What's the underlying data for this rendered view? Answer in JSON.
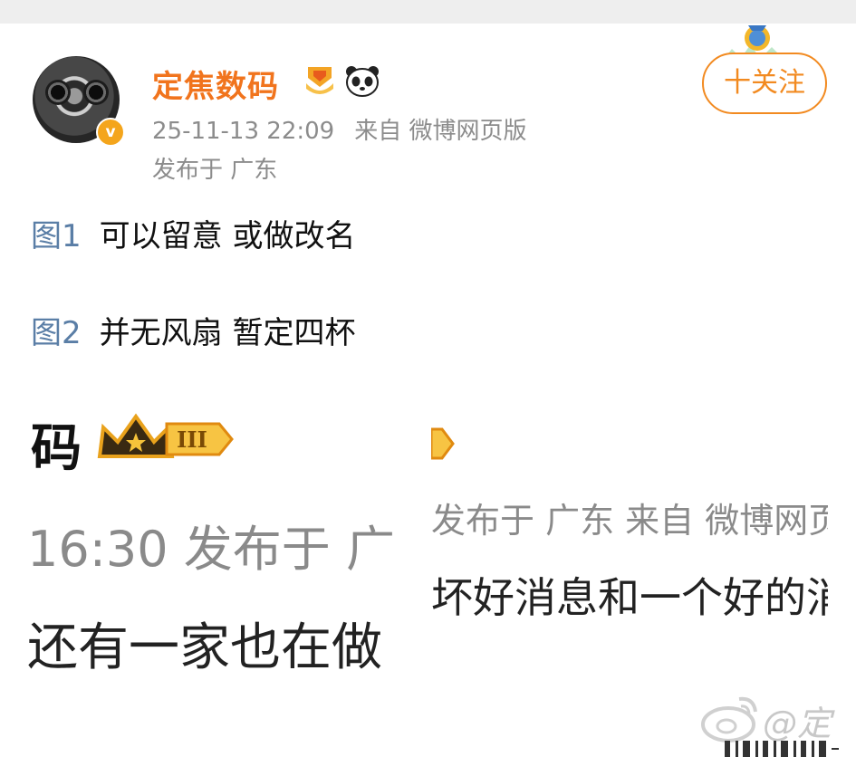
{
  "post": {
    "username": "定焦数码",
    "verified_mark": "v",
    "timestamp": "25-11-13 22:09",
    "source": "来自 微博网页版",
    "location": "发布于 广东",
    "follow_label": "十关注",
    "lines": [
      {
        "tag": "图1",
        "text": "可以留意 或做改名"
      },
      {
        "tag": "图2",
        "text": "并无风扇 暂定四杯"
      }
    ]
  },
  "screenshot": {
    "left": {
      "name_fragment": "码",
      "level_label": "III",
      "time_fragment": "16:30 发布于 广",
      "text_fragment": "还有一家也在做"
    },
    "right": {
      "meta_fragment": "发布于 广东 来自 微博网页",
      "text_fragment": "坏好消息和一个好的消"
    },
    "watermark_text": "@定"
  },
  "icons": {
    "medal": "medal-icon",
    "panda": "panda-icon",
    "crown": "crown-icon",
    "weibo": "weibo-logo-icon"
  },
  "colors": {
    "username": "#f1741d",
    "follow": "#f28a20",
    "tag": "#5a7ea6",
    "meta": "#8c8c8c"
  }
}
